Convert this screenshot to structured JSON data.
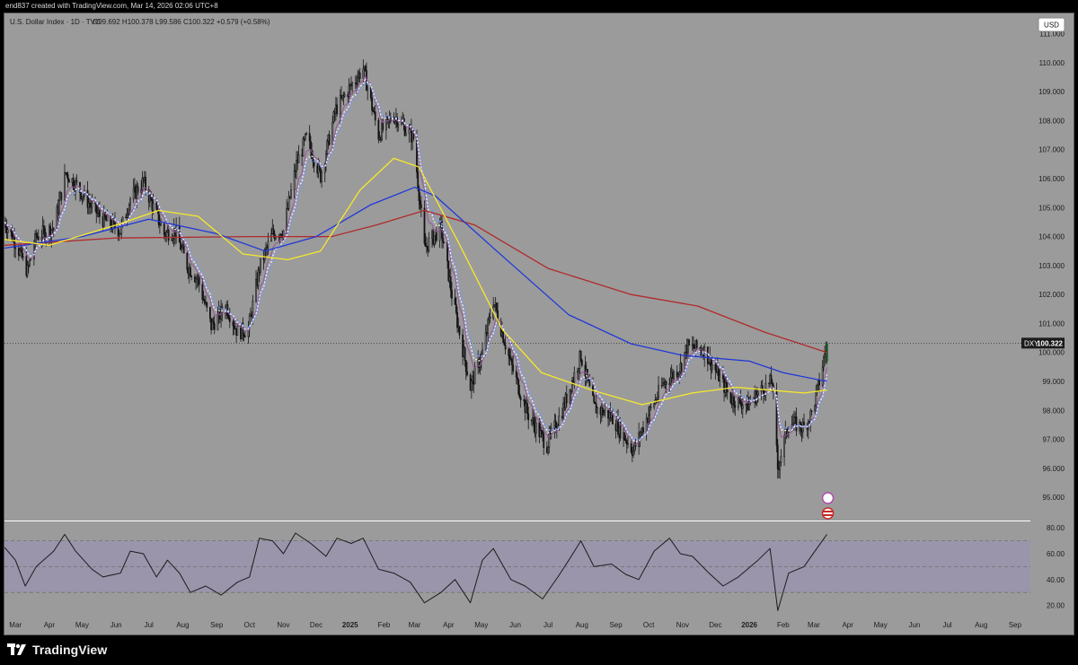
{
  "header": {
    "created_by": "end837 created with TradingView.com, Mar 14, 2026 02:06 UTC+8"
  },
  "legend": {
    "title": "U.S. Dollar Index · 1D · TVC",
    "ohlc": "O99.692 H100.378 L99.586 C100.322 +0.579 (+0.58%)"
  },
  "price_axis": {
    "currency": "USD",
    "ticks": [
      "111.000",
      "110.000",
      "109.000",
      "108.000",
      "107.000",
      "106.000",
      "105.000",
      "104.000",
      "103.000",
      "102.000",
      "101.000",
      "100.000",
      "99.000",
      "98.000",
      "97.000",
      "96.000",
      "95.000"
    ]
  },
  "price_badge": {
    "symbol": "DXY",
    "value": "100.322"
  },
  "rsi_axis": {
    "ticks": [
      "80.00",
      "60.00",
      "40.00",
      "20.00"
    ]
  },
  "time_axis": {
    "ticks": [
      "Mar",
      "Apr",
      "May",
      "Jun",
      "Jul",
      "Aug",
      "Sep",
      "Oct",
      "Nov",
      "Dec",
      "2025",
      "Feb",
      "Mar",
      "Apr",
      "May",
      "Jun",
      "Jul",
      "Aug",
      "Sep",
      "Oct",
      "Nov",
      "Dec",
      "2026",
      "Feb",
      "Mar",
      "Apr",
      "May",
      "Jun",
      "Jul",
      "Aug",
      "Sep"
    ]
  },
  "footer": {
    "brand": "TradingView"
  },
  "colors": {
    "pane_background": "#9b9b9b",
    "rsi_band": "#9a95ab",
    "candles": "#141414",
    "last_candle": "#1b5e20",
    "ma_yellow": "#f5e92b",
    "ma_blue": "#1f38d8",
    "ma_red": "#b02a2a",
    "ma_white_dotted": "#f2f2f2",
    "ma_blue_dotted": "#7d97ec",
    "ma_purple": "#93569a"
  },
  "chart_data": {
    "type": "candlestick",
    "symbol": "DXY",
    "timeframe": "1D",
    "last": {
      "open": 99.692,
      "high": 100.378,
      "low": 99.586,
      "close": 100.322,
      "change": 0.579,
      "change_pct": 0.58
    },
    "ylim": [
      94.2,
      111.7
    ],
    "close_path": {
      "dates": [
        "2024-02-20",
        "2024-03-01",
        "2024-03-12",
        "2024-03-20",
        "2024-04-05",
        "2024-04-16",
        "2024-04-25",
        "2024-05-10",
        "2024-05-20",
        "2024-06-05",
        "2024-06-14",
        "2024-06-26",
        "2024-07-03",
        "2024-07-15",
        "2024-07-25",
        "2024-08-05",
        "2024-08-15",
        "2024-08-27",
        "2024-09-10",
        "2024-09-20",
        "2024-09-30",
        "2024-10-10",
        "2024-10-22",
        "2024-11-01",
        "2024-11-13",
        "2024-11-22",
        "2024-12-05",
        "2024-12-19",
        "2025-01-02",
        "2025-01-13",
        "2025-01-27",
        "2025-02-10",
        "2025-02-28",
        "2025-03-10",
        "2025-03-25",
        "2025-04-04",
        "2025-04-21",
        "2025-05-02",
        "2025-05-12",
        "2025-05-28",
        "2025-06-12",
        "2025-06-30",
        "2025-07-14",
        "2025-07-31",
        "2025-08-12",
        "2025-08-28",
        "2025-09-17",
        "2025-09-30",
        "2025-10-14",
        "2025-10-30",
        "2025-11-05",
        "2025-11-20",
        "2025-12-01",
        "2025-12-15",
        "2025-12-31",
        "2026-01-09",
        "2026-01-22",
        "2026-01-27",
        "2026-02-06",
        "2026-02-20",
        "2026-02-27",
        "2026-03-05",
        "2026-03-13"
      ],
      "close": [
        104.5,
        103.8,
        102.8,
        104.0,
        104.3,
        106.2,
        105.8,
        105.0,
        104.6,
        104.2,
        105.3,
        105.9,
        105.2,
        104.1,
        104.2,
        103.0,
        102.5,
        100.9,
        101.6,
        100.7,
        100.8,
        102.9,
        104.1,
        104.2,
        106.5,
        107.4,
        106.1,
        108.4,
        109.2,
        109.8,
        107.5,
        108.2,
        107.4,
        103.6,
        104.3,
        102.0,
        98.8,
        100.0,
        101.8,
        99.6,
        97.9,
        96.8,
        98.0,
        99.9,
        98.1,
        97.8,
        96.6,
        97.8,
        98.9,
        99.5,
        100.2,
        100.1,
        99.4,
        98.4,
        98.2,
        98.6,
        99.0,
        96.0,
        97.6,
        97.4,
        97.9,
        98.8,
        100.32
      ]
    },
    "moving_averages": [
      {
        "color": "#b02a2a",
        "dates": [
          "2024-02-20",
          "2024-06-01",
          "2024-10-01",
          "2024-12-15",
          "2025-01-25",
          "2025-03-10",
          "2025-04-25",
          "2025-07-01",
          "2025-09-15",
          "2025-11-15",
          "2026-01-15",
          "2026-03-13"
        ],
        "values": [
          103.7,
          103.95,
          104.0,
          104.0,
          104.4,
          104.9,
          104.4,
          102.9,
          102.0,
          101.6,
          100.7,
          100.0
        ]
      },
      {
        "color": "#1f38d8",
        "dates": [
          "2024-02-20",
          "2024-05-01",
          "2024-07-01",
          "2024-09-01",
          "2024-10-15",
          "2024-12-01",
          "2025-01-20",
          "2025-03-01",
          "2025-03-20",
          "2025-05-15",
          "2025-07-20",
          "2025-09-15",
          "2025-11-01",
          "2026-01-01",
          "2026-02-01",
          "2026-03-13"
        ],
        "values": [
          103.6,
          104.0,
          104.6,
          104.1,
          103.5,
          104.0,
          105.1,
          105.7,
          105.4,
          103.5,
          101.3,
          100.3,
          99.9,
          99.7,
          99.3,
          99.0
        ]
      },
      {
        "color": "#f5e92b",
        "dates": [
          "2024-02-20",
          "2024-04-01",
          "2024-06-01",
          "2024-07-10",
          "2024-08-15",
          "2024-09-25",
          "2024-11-05",
          "2024-12-05",
          "2025-01-10",
          "2025-02-10",
          "2025-03-05",
          "2025-04-10",
          "2025-05-20",
          "2025-06-25",
          "2025-08-10",
          "2025-09-25",
          "2025-11-10",
          "2025-12-20",
          "2026-01-20",
          "2026-02-20",
          "2026-03-13"
        ],
        "values": [
          103.9,
          103.7,
          104.4,
          104.9,
          104.7,
          103.4,
          103.2,
          103.5,
          105.6,
          106.7,
          106.4,
          103.8,
          100.8,
          99.3,
          98.7,
          98.2,
          98.6,
          98.8,
          98.7,
          98.6,
          98.7
        ]
      }
    ],
    "rsi": {
      "ylim": [
        10,
        85
      ],
      "bands": [
        30,
        70
      ],
      "dates": [
        "2024-02-20",
        "2024-03-01",
        "2024-03-10",
        "2024-03-20",
        "2024-04-05",
        "2024-04-15",
        "2024-04-25",
        "2024-05-10",
        "2024-05-20",
        "2024-06-05",
        "2024-06-14",
        "2024-06-26",
        "2024-07-08",
        "2024-07-18",
        "2024-07-29",
        "2024-08-08",
        "2024-08-22",
        "2024-09-05",
        "2024-09-20",
        "2024-10-01",
        "2024-10-10",
        "2024-10-22",
        "2024-11-01",
        "2024-11-12",
        "2024-11-26",
        "2024-12-10",
        "2024-12-20",
        "2025-01-02",
        "2025-01-13",
        "2025-01-27",
        "2025-02-10",
        "2025-02-25",
        "2025-03-10",
        "2025-03-25",
        "2025-04-07",
        "2025-04-21",
        "2025-05-02",
        "2025-05-12",
        "2025-05-28",
        "2025-06-10",
        "2025-06-26",
        "2025-07-10",
        "2025-07-20",
        "2025-07-31",
        "2025-08-12",
        "2025-08-28",
        "2025-09-10",
        "2025-09-22",
        "2025-10-06",
        "2025-10-20",
        "2025-10-30",
        "2025-11-10",
        "2025-11-24",
        "2025-12-08",
        "2025-12-22",
        "2026-01-09",
        "2026-01-20",
        "2026-01-27",
        "2026-02-06",
        "2026-02-20",
        "2026-03-02",
        "2026-03-13"
      ],
      "values": [
        65,
        55,
        35,
        50,
        62,
        75,
        62,
        48,
        42,
        45,
        62,
        60,
        42,
        55,
        45,
        30,
        35,
        28,
        38,
        42,
        72,
        70,
        60,
        76,
        68,
        58,
        72,
        68,
        72,
        48,
        45,
        38,
        22,
        30,
        40,
        22,
        55,
        64,
        40,
        35,
        25,
        42,
        55,
        70,
        50,
        52,
        44,
        40,
        62,
        72,
        60,
        58,
        46,
        35,
        42,
        55,
        64,
        16,
        45,
        50,
        62,
        75
      ]
    }
  }
}
